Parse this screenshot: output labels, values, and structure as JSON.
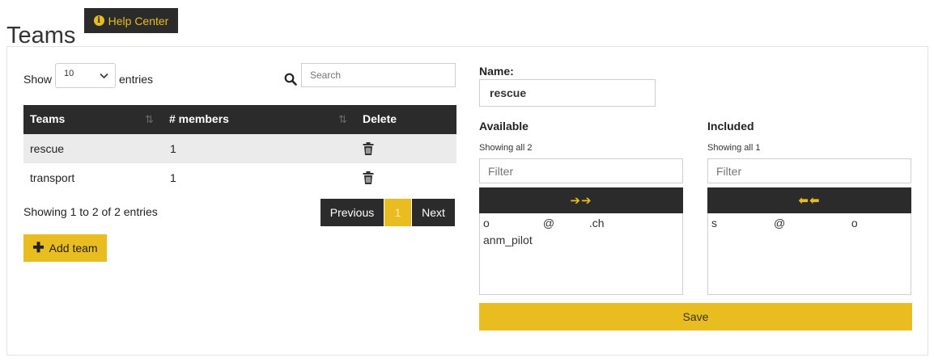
{
  "header": {
    "title": "Teams",
    "help_label": "Help Center"
  },
  "table_controls": {
    "show_label": "Show",
    "page_size": "10",
    "entries_label": "entries",
    "search_placeholder": "Search"
  },
  "table": {
    "columns": [
      "Teams",
      "# members",
      "Delete"
    ],
    "rows": [
      {
        "team": "rescue",
        "members": "1"
      },
      {
        "team": "transport",
        "members": "1"
      }
    ],
    "info": "Showing 1 to 2 of 2 entries"
  },
  "pagination": {
    "previous": "Previous",
    "current_page": "1",
    "next": "Next"
  },
  "add_team_label": "Add team",
  "editor": {
    "name_label": "Name:",
    "name_value": "rescue",
    "available": {
      "title": "Available",
      "count_text": "Showing all 2",
      "filter_placeholder": "Filter",
      "move_label": "➔➔",
      "options": [
        "o                 @           .ch",
        "anm_pilot"
      ]
    },
    "included": {
      "title": "Included",
      "count_text": "Showing all 1",
      "filter_placeholder": "Filter",
      "move_label": "⬅⬅",
      "options": [
        "s                  @                     o"
      ]
    },
    "save_label": "Save"
  },
  "colors": {
    "accent": "#e9bd1f",
    "dark": "#2b2b2b",
    "row_stripe": "#ebebeb"
  }
}
